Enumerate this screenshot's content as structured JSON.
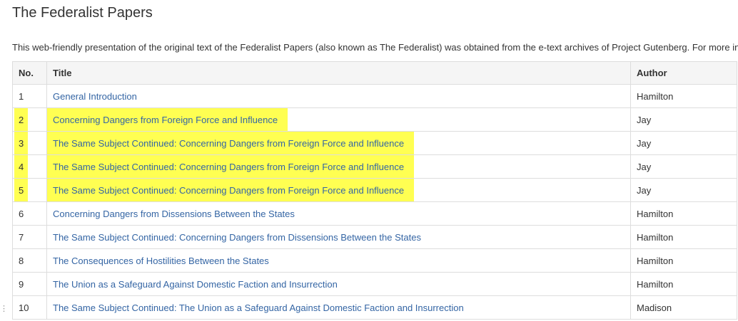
{
  "page": {
    "title": "The Federalist Papers",
    "intro": "This web-friendly presentation of the original text of the Federalist Papers (also known as The Federalist) was obtained from the e-text archives of Project Gutenberg. For more in"
  },
  "table": {
    "headers": {
      "no": "No.",
      "title": "Title",
      "author": "Author"
    },
    "rows": [
      {
        "no": "1",
        "title": "General Introduction",
        "author": "Hamilton",
        "highlighted": false
      },
      {
        "no": "2",
        "title": "Concerning Dangers from Foreign Force and Influence",
        "author": "Jay",
        "highlighted": true
      },
      {
        "no": "3",
        "title": "The Same Subject Continued: Concerning Dangers from Foreign Force and Influence",
        "author": "Jay",
        "highlighted": true
      },
      {
        "no": "4",
        "title": "The Same Subject Continued: Concerning Dangers from Foreign Force and Influence",
        "author": "Jay",
        "highlighted": true
      },
      {
        "no": "5",
        "title": "The Same Subject Continued: Concerning Dangers from Foreign Force and Influence",
        "author": "Jay",
        "highlighted": true
      },
      {
        "no": "6",
        "title": "Concerning Dangers from Dissensions Between the States",
        "author": "Hamilton",
        "highlighted": false
      },
      {
        "no": "7",
        "title": "The Same Subject Continued: Concerning Dangers from Dissensions Between the States",
        "author": "Hamilton",
        "highlighted": false
      },
      {
        "no": "8",
        "title": "The Consequences of Hostilities Between the States",
        "author": "Hamilton",
        "highlighted": false
      },
      {
        "no": "9",
        "title": "The Union as a Safeguard Against Domestic Faction and Insurrection",
        "author": "Hamilton",
        "highlighted": false
      },
      {
        "no": "10",
        "title": "The Same Subject Continued: The Union as a Safeguard Against Domestic Faction and Insurrection",
        "author": "Madison",
        "highlighted": false
      }
    ]
  },
  "colors": {
    "link": "#3465a4",
    "highlight": "#ffff52",
    "header_bg": "#f5f5f5",
    "border": "#dddddd"
  }
}
